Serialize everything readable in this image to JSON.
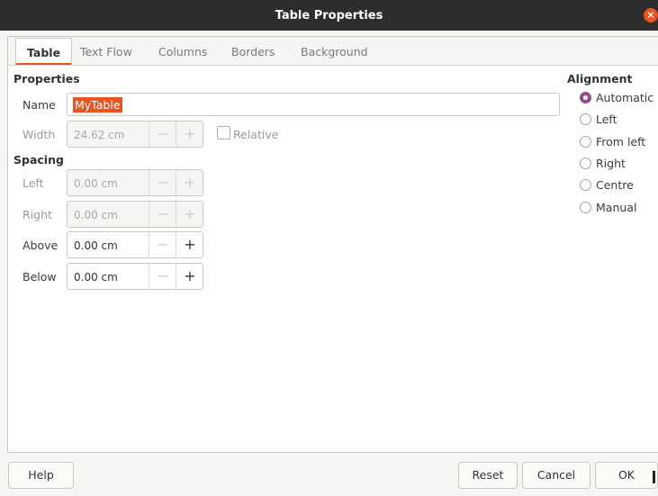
{
  "window": {
    "title": "Table Properties",
    "close_label": "×"
  },
  "tabs": [
    {
      "label": "Table",
      "active": true
    },
    {
      "label": "Text Flow"
    },
    {
      "label": "Columns"
    },
    {
      "label": "Borders"
    },
    {
      "label": "Background"
    }
  ],
  "properties": {
    "heading": "Properties",
    "name_label": "Name",
    "name_value": "MyTable",
    "width_label": "Width",
    "width_value": "24.62 cm",
    "relative_label": "Relative",
    "relative_checked": false
  },
  "spacing": {
    "heading": "Spacing",
    "left_label": "Left",
    "left_value": "0.00 cm",
    "right_label": "Right",
    "right_value": "0.00 cm",
    "above_label": "Above",
    "above_value": "0.00 cm",
    "below_label": "Below",
    "below_value": "0.00 cm",
    "minus": "−",
    "plus": "+"
  },
  "alignment": {
    "heading": "Alignment",
    "selected": "Automatic",
    "options": [
      "Automatic",
      "Left",
      "From left",
      "Right",
      "Centre",
      "Manual"
    ]
  },
  "buttons": {
    "help": "Help",
    "reset": "Reset",
    "cancel": "Cancel",
    "ok": "OK"
  },
  "colors": {
    "accent": "#e95420",
    "radio_selected": "#924d8b",
    "titlebar": "#2d2d2d"
  }
}
